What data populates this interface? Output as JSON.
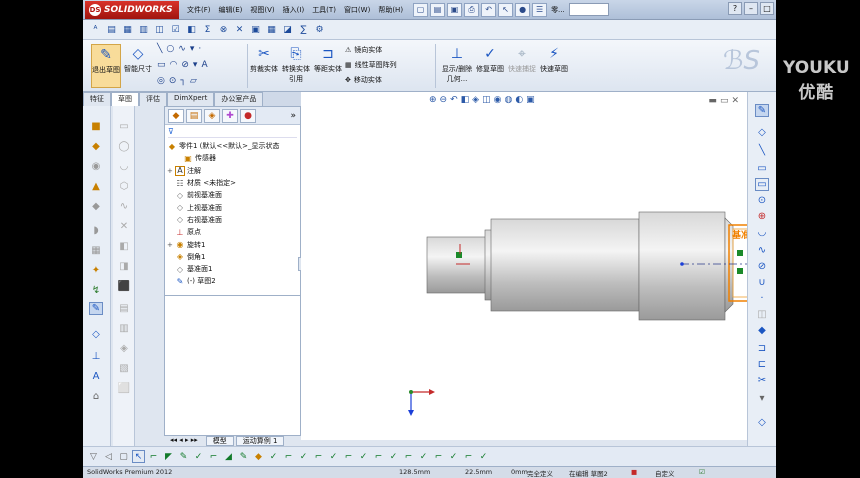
{
  "app": {
    "name": "SOLIDWORKS",
    "brand_color": "#c21a14"
  },
  "menus": [
    "文件(F)",
    "编辑(E)",
    "视图(V)",
    "插入(I)",
    "工具(T)",
    "窗口(W)",
    "帮助(H)"
  ],
  "window_title": "零...",
  "command_manager": {
    "sketch": "退出草图",
    "smart_dim": "智能尺寸",
    "trim": "剪裁实体",
    "convert": "转换实体引用",
    "offset": "等距实体",
    "mirror": "镜向实体",
    "pattern": "线性草图阵列",
    "move": "移动实体",
    "display": "显示/删除几何...",
    "repair": "修复草图",
    "quick_snaps": "快速捕捉",
    "rapid": "快速草图"
  },
  "tabs": [
    "特征",
    "草图",
    "评估",
    "DimXpert",
    "办公室产品"
  ],
  "selected_tab": "草图",
  "feature_tree": {
    "root": "零件1 (默认<<默认>_显示状态",
    "nodes": [
      {
        "label": "传感器",
        "icon": "sensor-icon"
      },
      {
        "label": "注解",
        "icon": "annotation-icon"
      },
      {
        "label": "材质 <未指定>",
        "icon": "material-icon"
      },
      {
        "label": "前视基准面",
        "icon": "plane-icon"
      },
      {
        "label": "上视基准面",
        "icon": "plane-icon"
      },
      {
        "label": "右视基准面",
        "icon": "plane-icon"
      },
      {
        "label": "原点",
        "icon": "origin-icon"
      },
      {
        "label": "旋转1",
        "icon": "revolve-icon"
      },
      {
        "label": "倒角1",
        "icon": "chamfer-icon"
      },
      {
        "label": "基准面1",
        "icon": "plane-icon"
      },
      {
        "label": "(-) 草图2",
        "icon": "sketch-icon"
      }
    ]
  },
  "viewport": {
    "plane_label": "基准面"
  },
  "bottom_tabs": [
    "模型",
    "运动算例 1"
  ],
  "status": {
    "product": "SolidWorks Premium 2012",
    "x": "128.5mm",
    "y": "22.5mm",
    "z": "0mm",
    "state": "完全定义",
    "editing": "在编辑 草图2",
    "custom": "自定义"
  },
  "watermark": {
    "en": "YOUKU",
    "cn": "优酷"
  }
}
